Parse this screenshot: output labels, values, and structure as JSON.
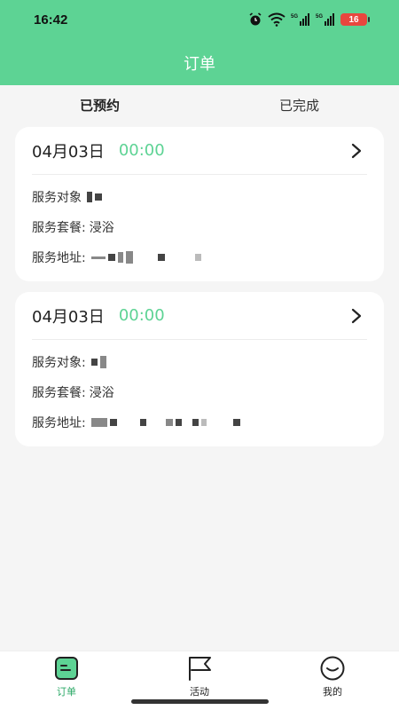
{
  "status_bar": {
    "time": "16:42",
    "battery": "16"
  },
  "header": {
    "title": "订单"
  },
  "tabs": [
    {
      "label": "已预约",
      "active": true
    },
    {
      "label": "已完成",
      "active": false
    }
  ],
  "orders": [
    {
      "date": "04月03日",
      "time": "00:00",
      "target_label": "服务对象",
      "package_label": "服务套餐:",
      "package_value": "浸浴",
      "address_label": "服务地址:"
    },
    {
      "date": "04月03日",
      "time": "00:00",
      "target_label": "服务对象:",
      "package_label": "服务套餐:",
      "package_value": "浸浴",
      "address_label": "服务地址:"
    }
  ],
  "bottom_nav": [
    {
      "label": "订单",
      "icon": "order-icon",
      "active": true
    },
    {
      "label": "活动",
      "icon": "flag-icon",
      "active": false
    },
    {
      "label": "我的",
      "icon": "smile-icon",
      "active": false
    }
  ],
  "colors": {
    "accent": "#5dd394",
    "active_nav": "#2aa866",
    "battery": "#e8473e"
  }
}
